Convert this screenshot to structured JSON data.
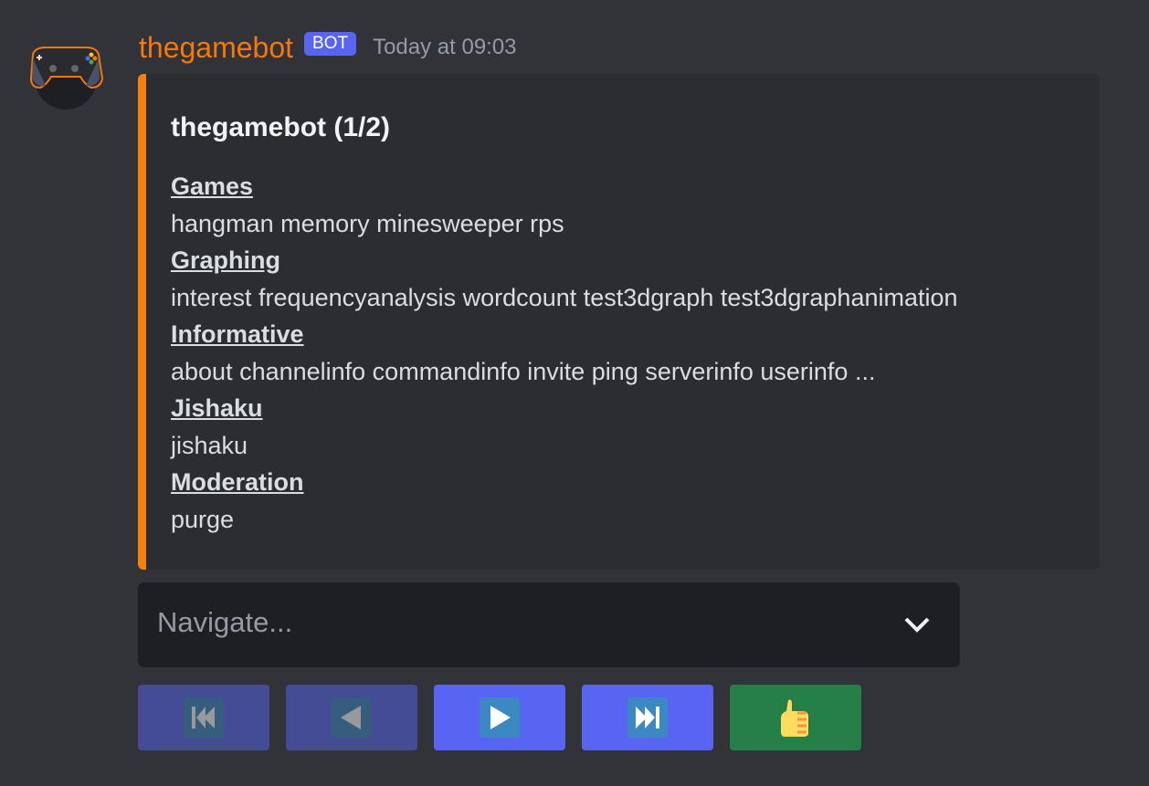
{
  "message": {
    "author": "thegamebot",
    "badge": "BOT",
    "timestamp": "Today at 09:03",
    "author_color": "#f5780a"
  },
  "embed": {
    "title": "thegamebot (1/2)",
    "accent_color": "#f5800a",
    "fields": [
      {
        "name": "Games",
        "value": "hangman memory minesweeper rps"
      },
      {
        "name": "Graphing",
        "value": "interest frequencyanalysis wordcount test3dgraph test3dgraphanimation"
      },
      {
        "name": "Informative",
        "value": "about channelinfo commandinfo invite ping serverinfo userinfo ..."
      },
      {
        "name": "Jishaku",
        "value": "jishaku"
      },
      {
        "name": "Moderation",
        "value": "purge"
      }
    ]
  },
  "select": {
    "placeholder": "Navigate..."
  },
  "buttons": [
    {
      "icon": "first-page-icon",
      "state": "disabled"
    },
    {
      "icon": "previous-page-icon",
      "state": "disabled"
    },
    {
      "icon": "next-page-icon",
      "state": "enabled"
    },
    {
      "icon": "last-page-icon",
      "state": "enabled"
    },
    {
      "icon": "thumbs-up-icon",
      "state": "enabled"
    }
  ]
}
